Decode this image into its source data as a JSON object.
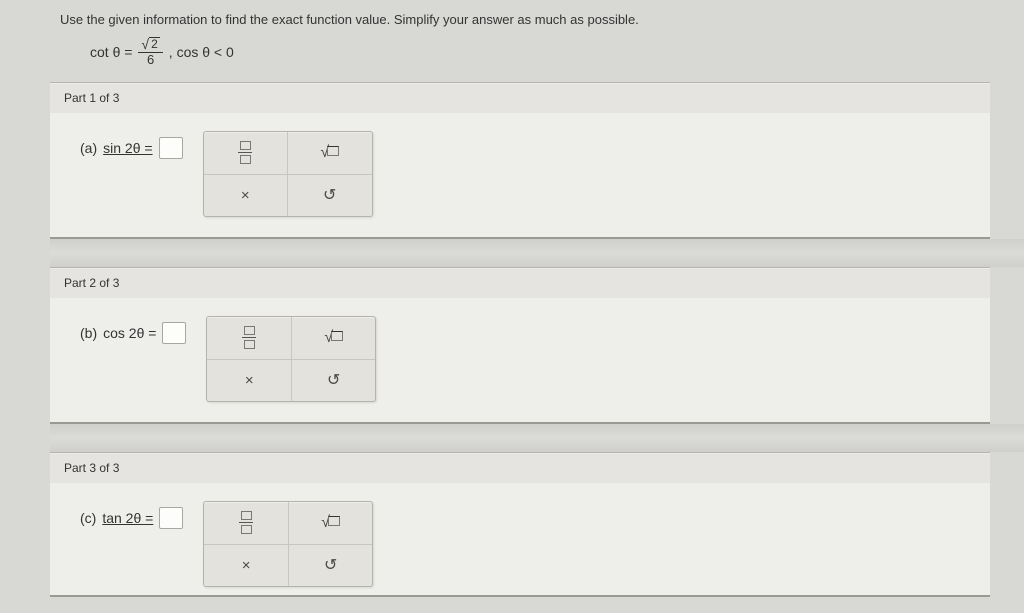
{
  "instruction": "Use the given information to find the exact function value. Simplify your answer as much as possible.",
  "given": {
    "lhs": "cot θ =",
    "frac_num_radicand": "2",
    "frac_den": "6",
    "cond": ",  cos θ < 0"
  },
  "parts": [
    {
      "header": "Part 1 of 3",
      "label": "(a)",
      "fn": "sin 2θ ="
    },
    {
      "header": "Part 2 of 3",
      "label": "(b)",
      "fn": "cos 2θ ="
    },
    {
      "header": "Part 3 of 3",
      "label": "(c)",
      "fn": "tan 2θ ="
    }
  ],
  "palette": {
    "close_glyph": "×",
    "undo_glyph": "↻"
  }
}
